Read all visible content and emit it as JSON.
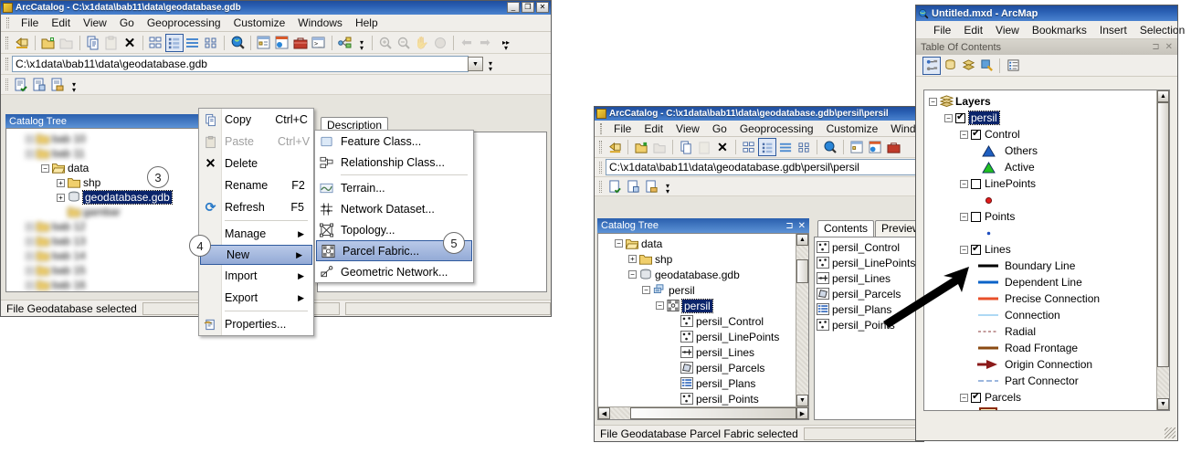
{
  "catalog_window": {
    "title": "ArcCatalog - C:\\x1data\\bab11\\data\\geodatabase.gdb",
    "window_buttons": {
      "minimize": "_",
      "maximize": "❐",
      "close": "✕"
    },
    "menus": [
      "File",
      "Edit",
      "View",
      "Go",
      "Geoprocessing",
      "Customize",
      "Windows",
      "Help"
    ],
    "location": {
      "value": "C:\\x1data\\bab11\\data\\geodatabase.gdb",
      "dropdown_glyph": "▼"
    },
    "panel_title": "Catalog Tree",
    "pin_glyph": "⊐",
    "tree": [
      {
        "label": "bab 10",
        "indent": 1,
        "expander": "+",
        "icon": "folder-icon",
        "blurred": true
      },
      {
        "label": "bab 11",
        "indent": 1,
        "expander": "+",
        "icon": "folder-icon",
        "blurred": true
      },
      {
        "label": "data",
        "indent": 2,
        "expander": "−",
        "icon": "folder-open-icon",
        "blurred": false
      },
      {
        "label": "shp",
        "indent": 3,
        "expander": "+",
        "icon": "folder-icon",
        "blurred": false
      },
      {
        "label": "geodatabase.gdb",
        "indent": 3,
        "expander": "+",
        "icon": "geodatabase-icon",
        "blurred": false,
        "selected": true
      },
      {
        "label": "gambar",
        "indent": 3,
        "expander": "",
        "icon": "folder-icon",
        "blurred": true
      },
      {
        "label": "bab 12",
        "indent": 1,
        "expander": "+",
        "icon": "folder-icon",
        "blurred": true
      },
      {
        "label": "bab 13",
        "indent": 1,
        "expander": "+",
        "icon": "folder-icon",
        "blurred": true
      },
      {
        "label": "bab 14",
        "indent": 1,
        "expander": "+",
        "icon": "folder-icon",
        "blurred": true
      },
      {
        "label": "bab 15",
        "indent": 1,
        "expander": "+",
        "icon": "folder-icon",
        "blurred": true
      },
      {
        "label": "bab 16",
        "indent": 1,
        "expander": "+",
        "icon": "folder-icon",
        "blurred": true
      }
    ],
    "description_tab": "Description",
    "status": "File Geodatabase selected"
  },
  "context_menu": {
    "items": [
      {
        "label": "Copy",
        "shortcut": "Ctrl+C",
        "icon": "copy-icon",
        "type": "item"
      },
      {
        "label": "Paste",
        "shortcut": "Ctrl+V",
        "icon": "paste-icon",
        "type": "item",
        "disabled": true
      },
      {
        "label": "Delete",
        "shortcut": "",
        "icon": "delete-x-icon",
        "type": "item"
      },
      {
        "label": "Rename",
        "shortcut": "F2",
        "icon": "",
        "type": "item"
      },
      {
        "label": "Refresh",
        "shortcut": "F5",
        "icon": "refresh-icon",
        "type": "item"
      },
      {
        "type": "separator"
      },
      {
        "label": "Manage",
        "shortcut": "",
        "icon": "",
        "type": "submenu"
      },
      {
        "label": "New",
        "shortcut": "",
        "icon": "",
        "type": "submenu",
        "highlighted": true
      },
      {
        "label": "Import",
        "shortcut": "",
        "icon": "",
        "type": "submenu"
      },
      {
        "label": "Export",
        "shortcut": "",
        "icon": "",
        "type": "submenu"
      },
      {
        "type": "separator"
      },
      {
        "label": "Properties...",
        "shortcut": "",
        "icon": "properties-icon",
        "type": "item"
      }
    ],
    "submenu_arrow": "▶"
  },
  "new_submenu": {
    "items": [
      {
        "label": "Feature Class...",
        "icon": "feature-class-icon"
      },
      {
        "label": "Relationship Class...",
        "icon": "relationship-class-icon"
      },
      {
        "type": "separator"
      },
      {
        "label": "Terrain...",
        "icon": "terrain-icon"
      },
      {
        "label": "Network Dataset...",
        "icon": "network-dataset-icon"
      },
      {
        "label": "Topology...",
        "icon": "topology-icon"
      },
      {
        "label": "Parcel Fabric...",
        "icon": "parcel-fabric-icon",
        "highlighted": true
      },
      {
        "label": "Geometric Network...",
        "icon": "geometric-network-icon"
      }
    ]
  },
  "callouts": [
    {
      "number": "3"
    },
    {
      "number": "4"
    },
    {
      "number": "5"
    }
  ],
  "catalog_window2": {
    "title": "ArcCatalog - C:\\x1data\\bab11\\data\\geodatabase.gdb\\persil\\persil",
    "menus": [
      "File",
      "Edit",
      "View",
      "Go",
      "Geoprocessing",
      "Customize",
      "Windows"
    ],
    "location": {
      "value": "C:\\x1data\\bab11\\data\\geodatabase.gdb\\persil\\persil"
    },
    "panel_title": "Catalog Tree",
    "pin_glyph": "⊐",
    "close_glyph": "✕",
    "tree": [
      {
        "label": "data",
        "indent": 1,
        "expander": "−",
        "icon": "folder-open-icon"
      },
      {
        "label": "shp",
        "indent": 2,
        "expander": "+",
        "icon": "folder-icon"
      },
      {
        "label": "geodatabase.gdb",
        "indent": 2,
        "expander": "−",
        "icon": "geodatabase-icon"
      },
      {
        "label": "persil",
        "indent": 3,
        "expander": "−",
        "icon": "feature-dataset-icon"
      },
      {
        "label": "persil",
        "indent": 4,
        "expander": "−",
        "icon": "parcel-fabric-icon",
        "selected": true
      },
      {
        "label": "persil_Control",
        "indent": 5,
        "expander": "",
        "icon": "point-feature-icon"
      },
      {
        "label": "persil_LinePoints",
        "indent": 5,
        "expander": "",
        "icon": "point-feature-icon"
      },
      {
        "label": "persil_Lines",
        "indent": 5,
        "expander": "",
        "icon": "line-feature-icon"
      },
      {
        "label": "persil_Parcels",
        "indent": 5,
        "expander": "",
        "icon": "polygon-feature-icon"
      },
      {
        "label": "persil_Plans",
        "indent": 5,
        "expander": "",
        "icon": "table-icon"
      },
      {
        "label": "persil_Points",
        "indent": 5,
        "expander": "",
        "icon": "point-feature-icon"
      }
    ],
    "tabs": [
      {
        "label": "Contents",
        "active": true
      },
      {
        "label": "Preview",
        "active": false
      }
    ],
    "contents": [
      {
        "label": "persil_Control",
        "icon": "point-feature-icon"
      },
      {
        "label": "persil_LinePoints",
        "icon": "point-feature-icon"
      },
      {
        "label": "persil_Lines",
        "icon": "line-feature-icon"
      },
      {
        "label": "persil_Parcels",
        "icon": "polygon-feature-icon"
      },
      {
        "label": "persil_Plans",
        "icon": "table-icon"
      },
      {
        "label": "persil_Points",
        "icon": "point-feature-icon"
      }
    ],
    "status": "File Geodatabase Parcel Fabric selected"
  },
  "arcmap_window": {
    "title": "Untitled.mxd - ArcMap",
    "title_icon": "arcmap-globe-icon",
    "menus": [
      "File",
      "Edit",
      "View",
      "Bookmarks",
      "Insert",
      "Selection"
    ],
    "toc_title": "Table Of Contents",
    "toc_pin_glyph": "⊐",
    "toc_close_glyph": "✕",
    "toc_buttons": [
      {
        "name": "list-by-drawing-order-icon",
        "active": true
      },
      {
        "name": "list-by-source-icon",
        "active": false
      },
      {
        "name": "list-by-visibility-icon",
        "active": false
      },
      {
        "name": "list-by-selection-icon",
        "active": false
      },
      {
        "name": "options-icon",
        "active": false
      }
    ],
    "layers": [
      {
        "label": "Layers",
        "indent": 0,
        "expander": "−",
        "kind": "root",
        "icon": "layers-icon"
      },
      {
        "label": "persil",
        "indent": 1,
        "expander": "−",
        "kind": "group",
        "checked": true,
        "selected": true
      },
      {
        "label": "Control",
        "indent": 2,
        "expander": "−",
        "kind": "layer",
        "checked": true
      },
      {
        "label": "Others",
        "indent": 3,
        "kind": "symbol",
        "symbol": "triangle",
        "color": "#1f5fc0"
      },
      {
        "label": "Active",
        "indent": 3,
        "kind": "symbol",
        "symbol": "triangle",
        "color": "#21c021"
      },
      {
        "label": "LinePoints",
        "indent": 2,
        "expander": "−",
        "kind": "layer",
        "checked": false
      },
      {
        "label": "",
        "indent": 3,
        "kind": "symbol",
        "symbol": "dot-large",
        "color": "#e01b1b"
      },
      {
        "label": "Points",
        "indent": 2,
        "expander": "−",
        "kind": "layer",
        "checked": false
      },
      {
        "label": "",
        "indent": 3,
        "kind": "symbol",
        "symbol": "dot-small",
        "color": "#1f4ec0"
      },
      {
        "label": "Lines",
        "indent": 2,
        "expander": "−",
        "kind": "layer",
        "checked": true
      },
      {
        "label": "Boundary Line",
        "indent": 3,
        "kind": "symbol",
        "symbol": "line",
        "color": "#000000",
        "width": 3,
        "style": "solid"
      },
      {
        "label": "Dependent Line",
        "indent": 3,
        "kind": "symbol",
        "symbol": "line",
        "color": "#0b63c8",
        "width": 3,
        "style": "solid"
      },
      {
        "label": "Precise Connection",
        "indent": 3,
        "kind": "symbol",
        "symbol": "line",
        "color": "#e8502a",
        "width": 3,
        "style": "solid"
      },
      {
        "label": "Connection",
        "indent": 3,
        "kind": "symbol",
        "symbol": "line",
        "color": "#5eb3e8",
        "width": 1,
        "style": "solid"
      },
      {
        "label": "Radial",
        "indent": 3,
        "kind": "symbol",
        "symbol": "line",
        "color": "#8b3a3a",
        "width": 1,
        "style": "dashed"
      },
      {
        "label": "Road Frontage",
        "indent": 3,
        "kind": "symbol",
        "symbol": "line",
        "color": "#8a4a12",
        "width": 3,
        "style": "solid"
      },
      {
        "label": "Origin Connection",
        "indent": 3,
        "kind": "symbol",
        "symbol": "arrow",
        "color": "#8b1a1a"
      },
      {
        "label": "Part Connector",
        "indent": 3,
        "kind": "symbol",
        "symbol": "line",
        "color": "#3a6fbf",
        "width": 1,
        "style": "dash-gap"
      },
      {
        "label": "Parcels",
        "indent": 2,
        "expander": "−",
        "kind": "layer",
        "checked": true
      },
      {
        "label": "",
        "indent": 3,
        "kind": "symbol",
        "symbol": "polygon",
        "color": "#fdf3c0",
        "outline": "#8a2b0b"
      }
    ]
  },
  "annotation_arrow": {
    "name": "pointer-arrow",
    "color": "#000000"
  }
}
